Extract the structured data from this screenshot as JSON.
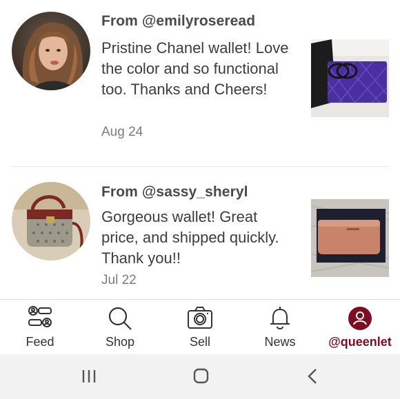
{
  "reviews": [
    {
      "from": "From @emilyroseread",
      "text": "Pristine Chanel wallet! Love the color and so functional too. Thanks and Cheers!",
      "date": "Aug 24",
      "avatar_icon": "user-photo-woman-curly-hair",
      "thumb_icon": "purple-quilted-wallet-photo"
    },
    {
      "from": "From @sassy_sheryl",
      "text": "Gorgeous wallet! Great price, and shipped quickly. Thank you!!",
      "date": "Jul 22",
      "avatar_icon": "user-photo-handbag",
      "thumb_icon": "rose-gold-wallet-photo"
    }
  ],
  "tabs": [
    {
      "label": "Feed",
      "icon": "feed-icon"
    },
    {
      "label": "Shop",
      "icon": "search-icon"
    },
    {
      "label": "Sell",
      "icon": "camera-icon"
    },
    {
      "label": "News",
      "icon": "bell-icon"
    },
    {
      "label": "@queenlet",
      "icon": "profile-icon",
      "active": true
    }
  ],
  "colors": {
    "accent": "#7f0d22",
    "text": "#3d3d3d",
    "muted": "#7b7b7b",
    "system_bar": "#f2f2f2"
  },
  "system_nav": [
    "recents-icon",
    "home-icon",
    "back-icon"
  ]
}
